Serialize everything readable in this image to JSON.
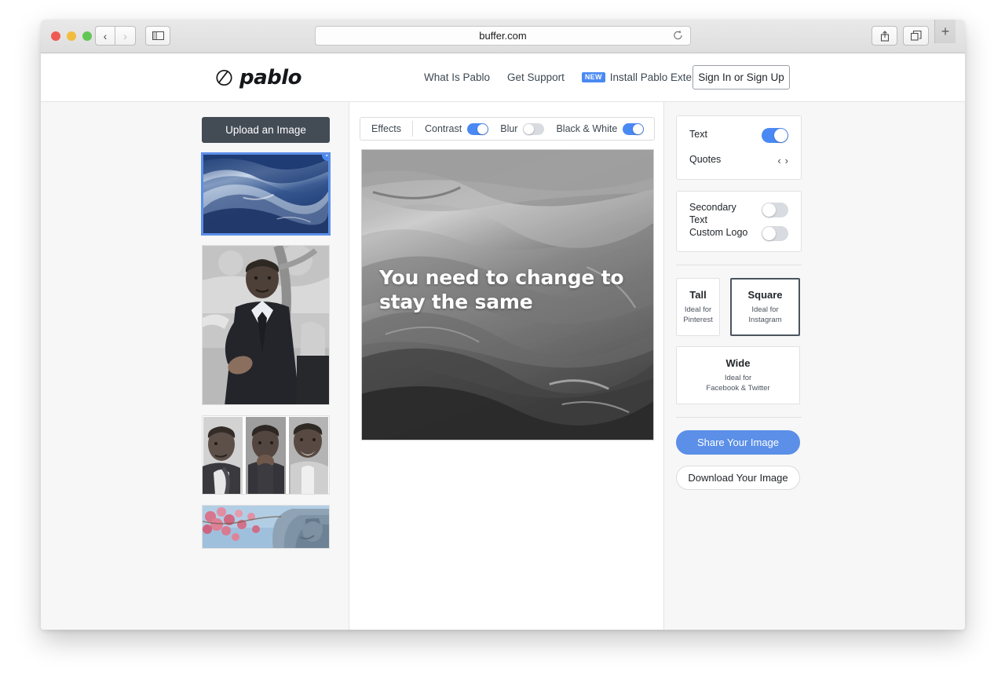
{
  "browser": {
    "url": "buffer.com",
    "reload_icon": "reload-icon",
    "back_icon": "‹",
    "forward_icon": "›",
    "sidebar_icon": "sidebar-icon",
    "share_icon": "share-icon",
    "tabs_icon": "tabs-icon",
    "new_tab_label": "+"
  },
  "header": {
    "logo_text": "pablo",
    "nav": [
      {
        "label": "What Is Pablo"
      },
      {
        "label": "Get Support"
      }
    ],
    "extension": {
      "badge": "NEW",
      "label": "Install Pablo Extension"
    },
    "signin_label": "Sign In or Sign Up"
  },
  "sidebar": {
    "upload_label": "Upload an Image",
    "thumbnails": [
      {
        "name": "ocean-waves",
        "selected": true,
        "alt": "Blue ocean waves"
      },
      {
        "name": "mlk-portrait",
        "selected": false,
        "alt": "Black and white portrait of Martin Luther King Jr."
      },
      {
        "name": "mlk-triptych",
        "selected": false,
        "alt": "Three black and white portraits of Martin Luther King Jr."
      },
      {
        "name": "mlk-memorial",
        "selected": false,
        "alt": "Cherry blossoms and the MLK memorial statue"
      }
    ],
    "check_glyph": "✓"
  },
  "effects": {
    "title": "Effects",
    "items": [
      {
        "label": "Contrast",
        "on": true
      },
      {
        "label": "Blur",
        "on": false
      },
      {
        "label": "Black & White",
        "on": true
      }
    ]
  },
  "canvas": {
    "quote": "You need to change to stay the same",
    "image_alt": "Grayscale ocean waves"
  },
  "options": {
    "text": {
      "label": "Text",
      "on": true
    },
    "quotes": {
      "label": "Quotes",
      "prev": "‹",
      "next": "›"
    },
    "secondary_text": {
      "label_line1": "Secondary",
      "label_line2": "Text",
      "on": false
    },
    "custom_logo": {
      "label": "Custom Logo",
      "on": false
    }
  },
  "sizes": [
    {
      "name": "tall",
      "title": "Tall",
      "sub_line1": "Ideal for",
      "sub_line2": "Pinterest",
      "selected": false
    },
    {
      "name": "square",
      "title": "Square",
      "sub_line1": "Ideal for",
      "sub_line2": "Instagram",
      "selected": true
    },
    {
      "name": "wide",
      "title": "Wide",
      "sub_line1": "Ideal for",
      "sub_line2": "Facebook & Twitter",
      "selected": false
    }
  ],
  "actions": {
    "share_label": "Share Your Image",
    "download_label": "Download Your Image"
  },
  "colors": {
    "accent_blue": "#4a89f3",
    "share_blue": "#5b8fe8",
    "upload_dark": "#434b55",
    "selected_border": "#4c545e"
  }
}
